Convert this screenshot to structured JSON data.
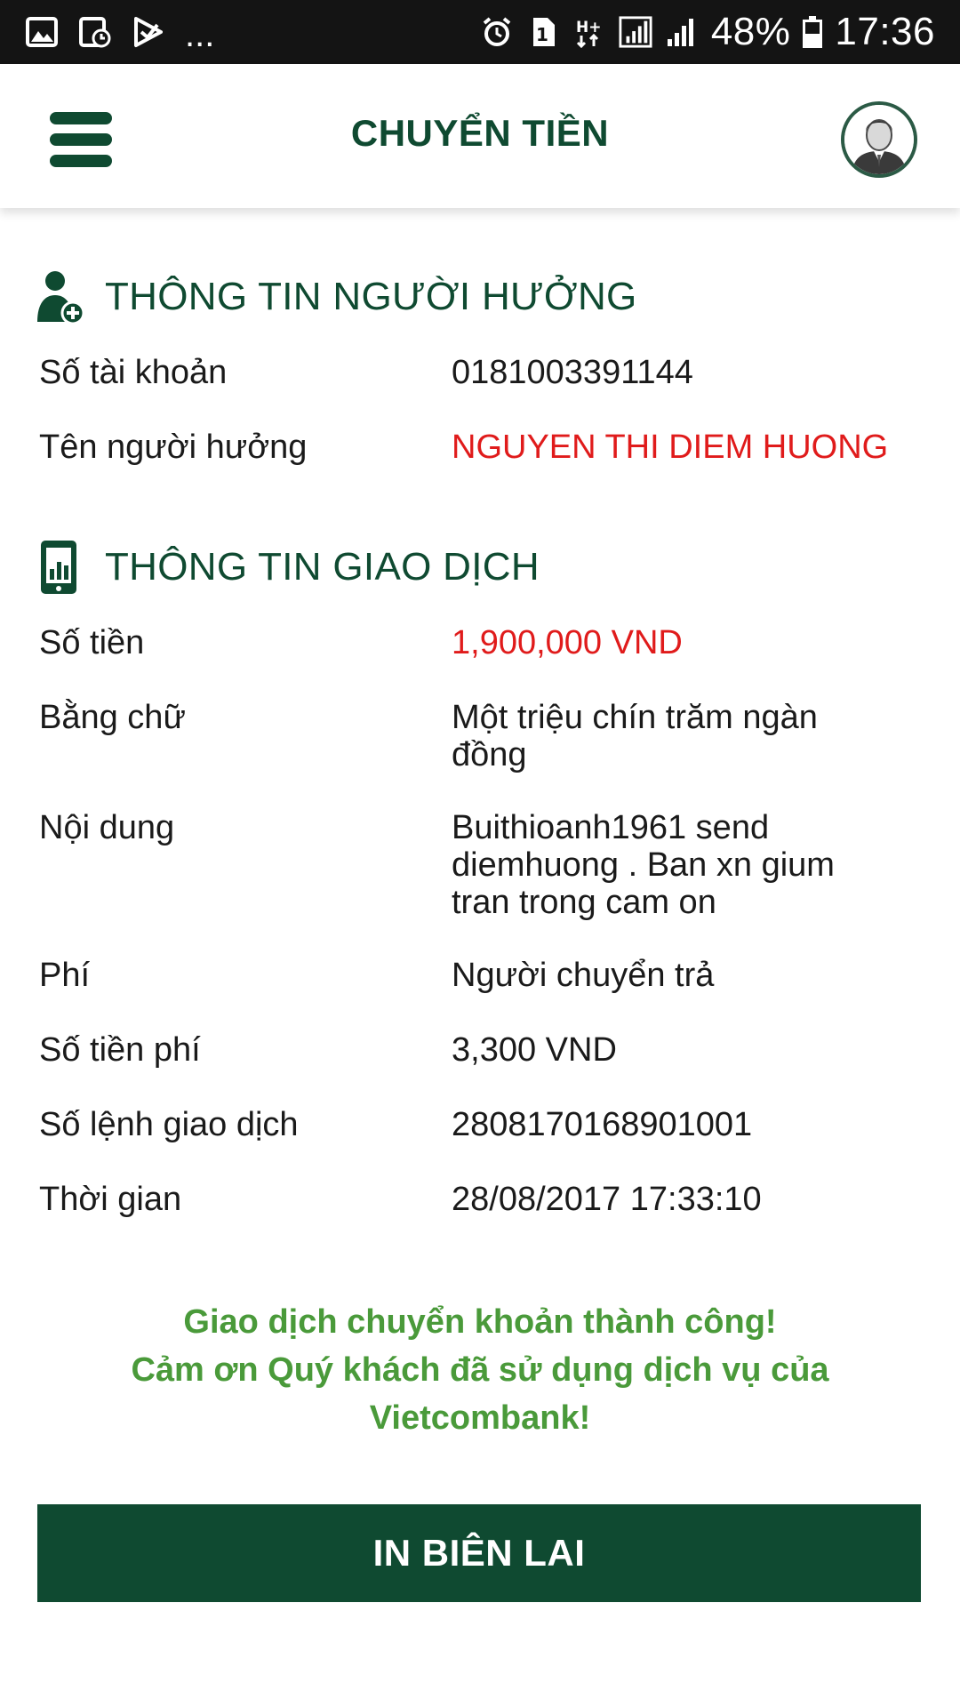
{
  "status_bar": {
    "battery": "48%",
    "time": "17:36",
    "overflow": "...",
    "network": "H+",
    "notification_count": "1"
  },
  "header": {
    "title": "CHUYỂN TIỀN"
  },
  "beneficiary": {
    "title": "THÔNG TIN NGƯỜI HƯỞNG",
    "rows": [
      {
        "label": "Số tài khoản",
        "value": "0181003391144"
      },
      {
        "label": "Tên người hưởng",
        "value": "NGUYEN THI DIEM HUONG"
      }
    ]
  },
  "transaction": {
    "title": "THÔNG TIN GIAO DỊCH",
    "rows": [
      {
        "label": "Số tiền",
        "value": "1,900,000 VND"
      },
      {
        "label": "Bằng chữ",
        "value_lines": [
          "Một triệu chín trăm ngàn",
          "đồng"
        ]
      },
      {
        "label": "Nội dung",
        "value_lines": [
          "Buithioanh1961 send",
          "diemhuong . Ban xn gium",
          "tran trong cam on"
        ]
      },
      {
        "label": "Phí",
        "value": "Người chuyển trả"
      },
      {
        "label": "Số tiền phí",
        "value": "3,300 VND"
      },
      {
        "label": "Số lệnh giao dịch",
        "value": "2808170168901001"
      },
      {
        "label": "Thời gian",
        "value": "28/08/2017 17:33:10"
      }
    ]
  },
  "success_message": {
    "lines": [
      "Giao dịch chuyển khoản thành công!",
      "Cảm ơn Quý khách đã sử dụng dịch vụ của",
      "Vietcombank!"
    ]
  },
  "print_button": {
    "label": "IN BIÊN LAI"
  },
  "colors": {
    "brand_green": "#0f4a31",
    "highlight_red": "#e01b1b",
    "success_green": "#4a9a3a"
  }
}
